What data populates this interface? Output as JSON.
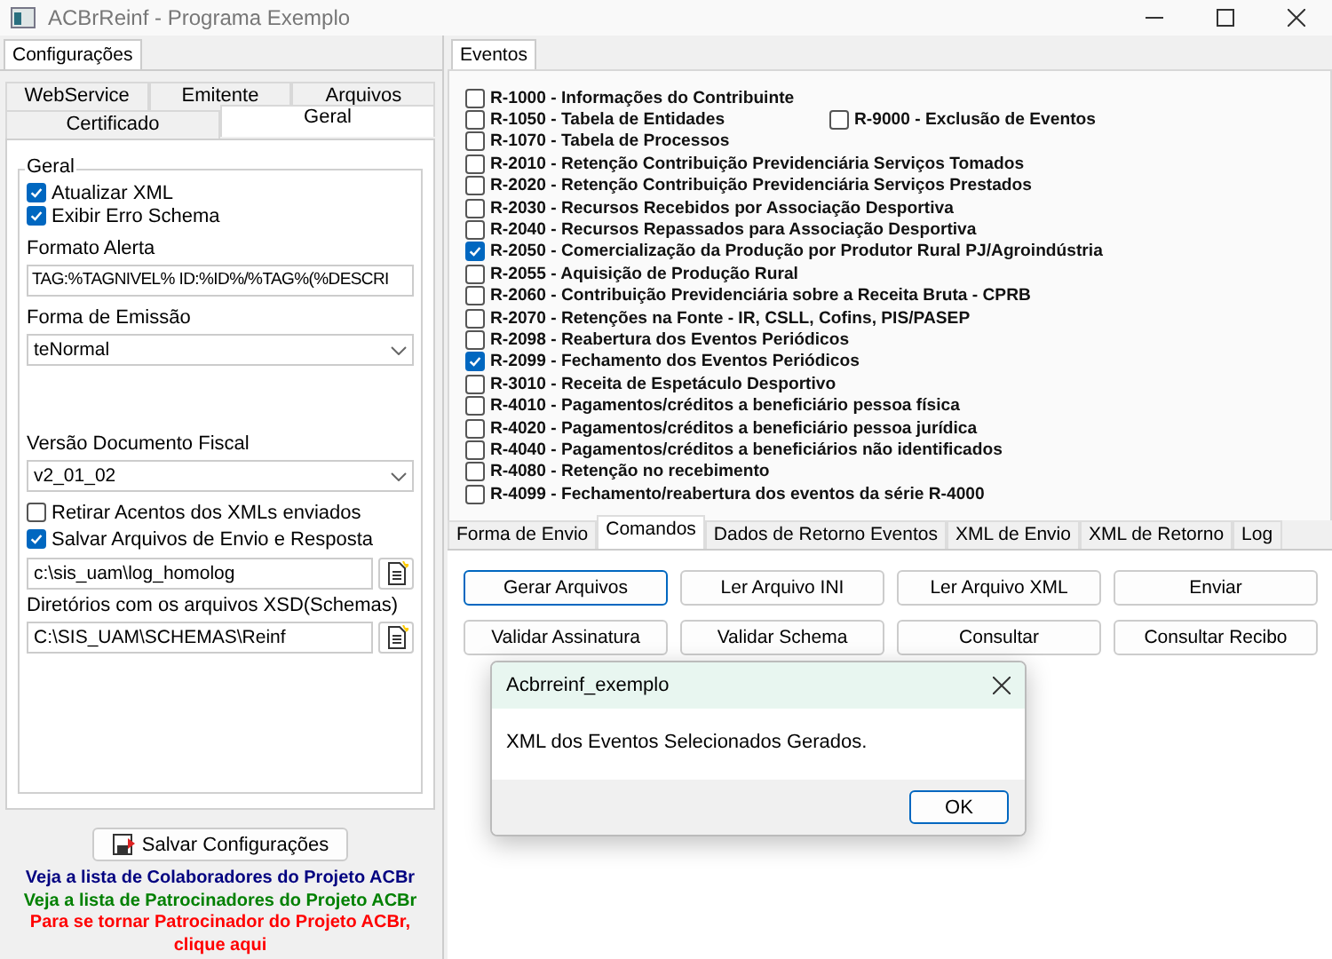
{
  "window": {
    "title": "ACBrReinf - Programa Exemplo"
  },
  "config_panel": {
    "tab": {
      "label": "Configurações",
      "selected": true
    },
    "tab_rows": [
      [
        {
          "label": "WebService",
          "selected": false
        },
        {
          "label": "Emitente",
          "selected": false
        },
        {
          "label": "Arquivos",
          "selected": false
        }
      ],
      [
        {
          "label": "Certificado",
          "selected": false
        },
        {
          "label": "Geral",
          "selected": true
        }
      ]
    ],
    "group": {
      "title": "Geral",
      "checkboxes": [
        {
          "label": "Atualizar XML",
          "checked": true
        },
        {
          "label": "Exibir Erro Schema",
          "checked": true
        }
      ],
      "formato_alerta": {
        "label": "Formato Alerta",
        "value": "TAG:%TAGNIVEL% ID:%ID%/%TAG%(%DESCRI"
      },
      "forma_emissao": {
        "label": "Forma de Emissão",
        "value": "teNormal"
      },
      "versao": {
        "label": "Versão Documento Fiscal",
        "value": "v2_01_02"
      },
      "options": [
        {
          "label": "Retirar Acentos dos XMLs enviados",
          "checked": false
        },
        {
          "label": "Salvar Arquivos de Envio e Resposta",
          "checked": true
        }
      ],
      "log_path": {
        "value": "c:\\sis_uam\\log_homolog"
      },
      "schemas_dir": {
        "label": "Diretórios com os arquivos XSD(Schemas)",
        "value": "C:\\SIS_UAM\\SCHEMAS\\Reinf"
      }
    },
    "save_button": "Salvar Configurações",
    "links": [
      {
        "text": "Veja a lista de Colaboradores do Projeto ACBr",
        "color": "#000080"
      },
      {
        "text": "Veja a lista de Patrocinadores do Projeto ACBr",
        "color": "#008000"
      },
      {
        "text": "Para se tornar Patrocinador do Projeto ACBr, clique aqui",
        "color": "#ff0000"
      }
    ]
  },
  "events_panel": {
    "tab": {
      "label": "Eventos",
      "selected": true
    },
    "events": [
      {
        "label": "R-1000 - Informações do Contribuinte",
        "checked": false
      },
      {
        "label": "R-1050 - Tabela de Entidades",
        "checked": false
      },
      {
        "label": "R-1070 - Tabela de Processos",
        "checked": false
      },
      {
        "label": "R-2010 - Retenção Contribuição Previdenciária  Serviços Tomados",
        "checked": false
      },
      {
        "label": "R-2020 - Retenção Contribuição Previdenciária  Serviços Prestados",
        "checked": false
      },
      {
        "label": "R-2030 - Recursos Recebidos por Associação Desportiva",
        "checked": false
      },
      {
        "label": "R-2040 - Recursos Repassados para Associação Desportiva",
        "checked": false
      },
      {
        "label": "R-2050 - Comercialização da Produção por Produtor Rural PJ/Agroindústria",
        "checked": true
      },
      {
        "label": "R-2055 - Aquisição de Produção Rural",
        "checked": false
      },
      {
        "label": "R-2060 - Contribuição Previdenciária sobre a Receita Bruta - CPRB",
        "checked": false
      },
      {
        "label": "R-2070 - Retenções na Fonte - IR, CSLL, Cofins, PIS/PASEP",
        "checked": false
      },
      {
        "label": "R-2098 - Reabertura dos Eventos Periódicos",
        "checked": false
      },
      {
        "label": "R-2099 - Fechamento dos Eventos Periódicos",
        "checked": true
      },
      {
        "label": "R-3010 - Receita de Espetáculo Desportivo",
        "checked": false
      },
      {
        "label": "R-4010 - Pagamentos/créditos a beneficiário pessoa física",
        "checked": false
      },
      {
        "label": "R-4020 - Pagamentos/créditos a beneficiário pessoa jurídica",
        "checked": false
      },
      {
        "label": "R-4040 - Pagamentos/créditos a beneficiários não identificados",
        "checked": false
      },
      {
        "label": "R-4080 - Retenção no recebimento",
        "checked": false
      },
      {
        "label": "R-4099 - Fechamento/reabertura dos eventos da série R-4000",
        "checked": false
      }
    ],
    "events_column_2": [
      {
        "label": "R-9000 - Exclusão de Eventos",
        "checked": false
      }
    ]
  },
  "bottom_tabs": [
    {
      "label": "Forma de Envio",
      "selected": false
    },
    {
      "label": "Comandos",
      "selected": true
    },
    {
      "label": "Dados de Retorno Eventos",
      "selected": false
    },
    {
      "label": "XML de Envio",
      "selected": false
    },
    {
      "label": "XML de Retorno",
      "selected": false
    },
    {
      "label": "Log",
      "selected": false
    }
  ],
  "commands": [
    {
      "label": "Gerar Arquivos",
      "default": true
    },
    {
      "label": "Ler Arquivo INI",
      "default": false
    },
    {
      "label": "Ler Arquivo XML",
      "default": false
    },
    {
      "label": "Enviar",
      "default": false
    },
    {
      "label": "Validar Assinatura",
      "default": false
    },
    {
      "label": "Validar Schema",
      "default": false
    },
    {
      "label": "Consultar",
      "default": false
    },
    {
      "label": "Consultar Recibo",
      "default": false
    }
  ],
  "dialog": {
    "title": "Acbrreinf_exemplo",
    "message": "XML dos Eventos Selecionados Gerados.",
    "ok_button": "OK"
  }
}
